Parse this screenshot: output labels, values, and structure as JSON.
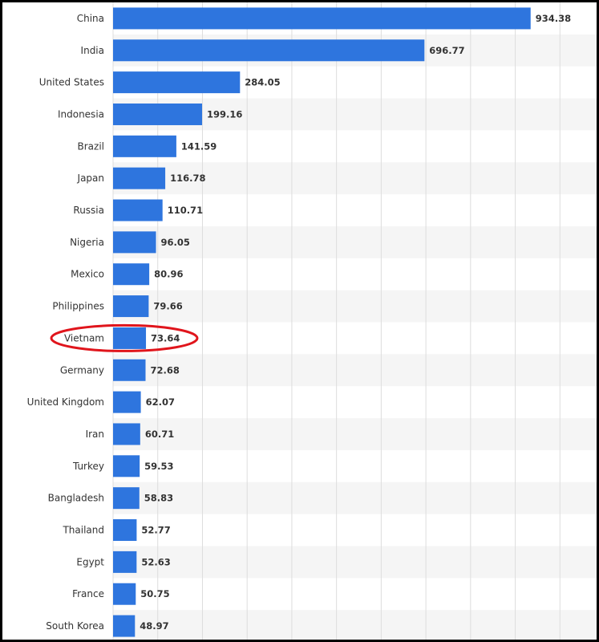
{
  "chart_data": {
    "type": "bar",
    "orientation": "horizontal",
    "title": "",
    "xlabel": "",
    "ylabel": "",
    "xlim": [
      0,
      1000
    ],
    "grid": true,
    "legend": "none",
    "categories": [
      "China",
      "India",
      "United States",
      "Indonesia",
      "Brazil",
      "Japan",
      "Russia",
      "Nigeria",
      "Mexico",
      "Philippines",
      "Vietnam",
      "Germany",
      "United Kingdom",
      "Iran",
      "Turkey",
      "Bangladesh",
      "Thailand",
      "Egypt",
      "France",
      "South Korea"
    ],
    "values": [
      934.38,
      696.77,
      284.05,
      199.16,
      141.59,
      116.78,
      110.71,
      96.05,
      80.96,
      79.66,
      73.64,
      72.68,
      62.07,
      60.71,
      59.53,
      58.83,
      52.77,
      52.63,
      50.75,
      48.97
    ],
    "value_labels": [
      "934.38",
      "696.77",
      "284.05",
      "199.16",
      "141.59",
      "116.78",
      "110.71",
      "96.05",
      "80.96",
      "79.66",
      "73.64",
      "72.68",
      "62.07",
      "60.71",
      "59.53",
      "58.83",
      "52.77",
      "52.63",
      "50.75",
      "48.97"
    ],
    "highlighted_category": "Vietnam",
    "colors": {
      "bar": "#2e75de",
      "stripe": "#f5f5f5",
      "grid": "#dddddd",
      "highlight": "#e0151c",
      "border": "#000000"
    }
  }
}
